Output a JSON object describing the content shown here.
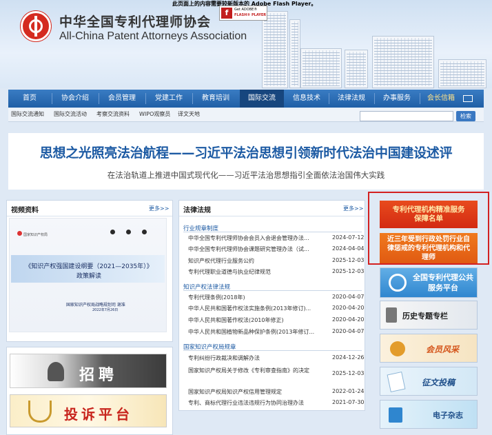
{
  "header": {
    "flash_notice": "此页面上的内容需要较新版本的 Adobe Flash Player。",
    "site_name_cn": "中华全国专利代理师协会",
    "site_name_en": "All-China Patent Attorneys Association",
    "flash_badge_line1": "Get ADOBE®",
    "flash_badge_line2": "FLASH® PLAYER"
  },
  "nav": {
    "items": [
      "首页",
      "协会介绍",
      "会员管理",
      "党建工作",
      "教育培训",
      "国际交流",
      "信息技术",
      "法律法规",
      "办事服务",
      "会长信箱"
    ],
    "active": "国际交流"
  },
  "subnav": {
    "items": [
      "国际交流通知",
      "国际交流活动",
      "考察交流资料",
      "WIPO观察员",
      "译文天地"
    ]
  },
  "search": {
    "value": "",
    "button_label": "检索"
  },
  "banner": {
    "title": "思想之光照亮法治航程——习近平法治思想引领新时代法治中国建设述评",
    "subtitle": "在法治轨道上推进中国式现代化——习近平法治思想指引全面依法治国伟大实践"
  },
  "video_panel": {
    "title": "视频资料",
    "more": "更多>>",
    "logo_text": "国家知识产权局",
    "card_title_line1": "《知识产权强国建设纲要（2021—2035年）》",
    "card_title_line2": "政策解读",
    "card_org": "国家知识产权局战略规划司  谢准",
    "card_date": "2022年7月26日"
  },
  "promos": {
    "recruit": "招聘",
    "complaint": "投诉平台"
  },
  "law_panel": {
    "title": "法律法规",
    "more": "更多>>",
    "categories": [
      {
        "name": "行业规章制度",
        "items": [
          {
            "title": "中华全国专利代理师协会会员入会退会管理办法...",
            "date": "2024-07-12"
          },
          {
            "title": "中华全国专利代理师协会课题研究管理办法（试...",
            "date": "2024-04-04"
          },
          {
            "title": "知识产权代理行业服务公约",
            "date": "2025-12-03"
          },
          {
            "title": "专利代理职业道德与执业纪律规范",
            "date": "2025-12-03"
          }
        ]
      },
      {
        "name": "知识产权法律法规",
        "items": [
          {
            "title": "专利代理条例(2018年)",
            "date": "2020-04-07"
          },
          {
            "title": "中华人民共和国著作权法实施条例(2013年修订)...",
            "date": "2020-04-20"
          },
          {
            "title": "中华人民共和国著作权法(2010年修正)",
            "date": "2020-04-20"
          },
          {
            "title": "中华人民共和国植物新品种保护条例(2013年修订...",
            "date": "2020-04-07"
          }
        ]
      },
      {
        "name": "国家知识产权局规章",
        "items": [
          {
            "title": "专利纠纷行政裁决和调解办法",
            "date": "2024-12-26"
          },
          {
            "title": "国家知识产权局关于修改《专利审查指南》的决定",
            "date": "2025-12-03"
          },
          {
            "title": "国家知识产权局知识产权信用管理规定",
            "date": "2022-01-24"
          },
          {
            "title": "专利、商标代理行业违法违规行为协同治理办法",
            "date": "2021-07-30"
          }
        ]
      }
    ]
  },
  "right_column": {
    "red1": "专利代理机构精准服务保障名单",
    "red2": "近三年受到行政处罚行业自律惩戒的专利代理机构和代理师",
    "service_platform": "全国专利代理公共服务平台",
    "history": "历史专题专栏",
    "member_style": "会员风采",
    "essay": "征文投稿",
    "ezine": "电子杂志"
  },
  "colors": {
    "nav_blue": "#1f5fa6",
    "banner_title_blue": "#1c5aa3",
    "highlight_red": "#d32020"
  }
}
